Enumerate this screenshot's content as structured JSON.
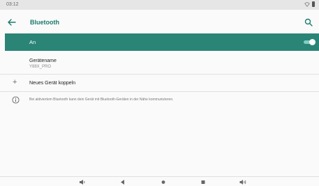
{
  "status_bar": {
    "time": "03:12",
    "icons": [
      "wifi-icon",
      "battery-icon"
    ]
  },
  "toolbar": {
    "title": "Bluetooth",
    "back_icon": "arrow-left-icon",
    "search_icon": "search-icon"
  },
  "master_switch": {
    "label": "An",
    "enabled": true
  },
  "device_name": {
    "title": "Gerätename",
    "value": "Y88X_PRO"
  },
  "pair_new": {
    "label": "Neues Gerät koppeln",
    "icon": "plus-icon"
  },
  "info": {
    "text": "Bei aktiviertem Bluetooth kann dein Gerät mit Bluetooth-Geräten in der Nähe kommunizieren.",
    "icon": "info-icon"
  },
  "nav_bar": {
    "buttons": [
      "volume-down-icon",
      "back-triangle-icon",
      "home-dot-icon",
      "recents-square-icon",
      "volume-up-icon"
    ]
  },
  "colors": {
    "accent": "#2a8577",
    "title": "#1a7a6c",
    "background": "#fafafa"
  }
}
